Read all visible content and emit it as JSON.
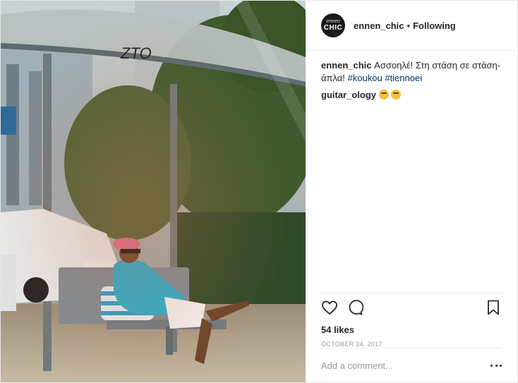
{
  "post": {
    "photo_alt": "photo",
    "author": {
      "username": "ennen_chic",
      "avatar_line1": "ennen",
      "avatar_line2": "CHIC",
      "separator": "•",
      "follow_status": "Following"
    },
    "caption": {
      "username": "ennen_chic",
      "text": "Ασσοηλέ! Στη στάση σε στάση-άπλα!",
      "hashtags": [
        "#koukou",
        "#tiennoei"
      ]
    },
    "comments": [
      {
        "username": "guitar_ology",
        "emojis": [
          "grinning-sweat-emoji",
          "grinning-sweat-emoji"
        ]
      }
    ],
    "likes_text": "54 likes",
    "date_text": "OCTOBER 24, 2017",
    "add_comment_placeholder": "Add a comment...",
    "icons": [
      "heart-icon",
      "comment-icon",
      "bookmark-icon",
      "more-options-icon"
    ]
  }
}
